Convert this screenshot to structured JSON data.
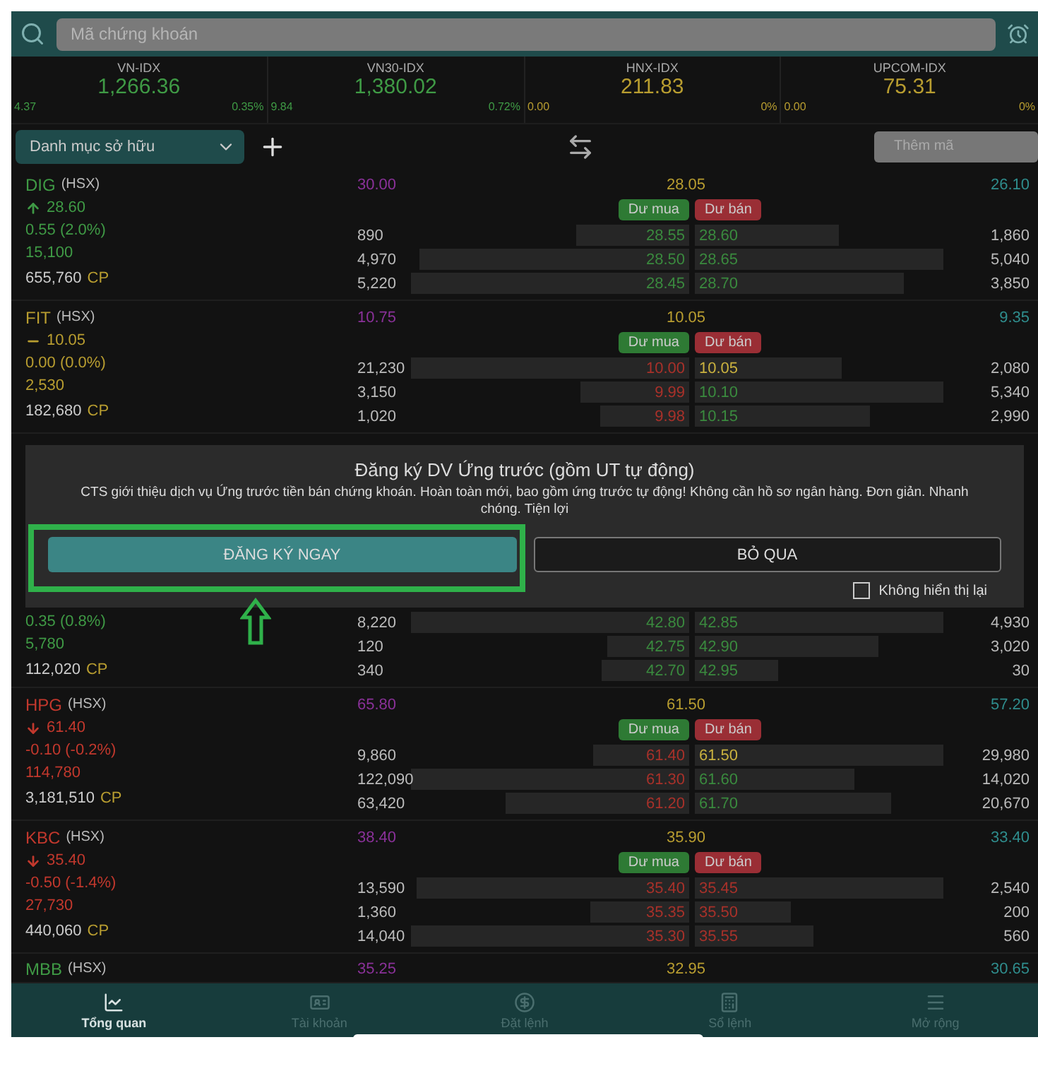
{
  "search": {
    "placeholder": "Mã chứng khoán"
  },
  "indices": [
    {
      "name": "VN-IDX",
      "value": "1,266.36",
      "change": "4.37",
      "percent": "0.35%",
      "color": "#3f9a45"
    },
    {
      "name": "VN30-IDX",
      "value": "1,380.02",
      "change": "9.84",
      "percent": "0.72%",
      "color": "#3f9a45"
    },
    {
      "name": "HNX-IDX",
      "value": "211.83",
      "change": "0.00",
      "percent": "0%",
      "color": "#b89d30"
    },
    {
      "name": "UPCOM-IDX",
      "value": "75.31",
      "change": "0.00",
      "percent": "0%",
      "color": "#b89d30"
    }
  ],
  "toolbar": {
    "watchlist": "Danh mục sở hữu",
    "add_symbol": {
      "placeholder": "Thêm mã"
    }
  },
  "stocks": [
    {
      "symbol": "DIG",
      "exchange": "(HSX)",
      "kind": "up",
      "color": "#3f9a45",
      "price": "28.60",
      "change": "0.55 (2.0%)",
      "volume": "15,100",
      "holding": "655,760",
      "holding_unit": "CP",
      "ceiling": "30.00",
      "reference": "28.05",
      "floor": "26.10",
      "buy_label": "Dư mua",
      "sell_label": "Dư bán",
      "book": [
        {
          "bid": {
            "volume": "890",
            "price": "28.55",
            "color": "#3a8a3e"
          },
          "ask": {
            "volume": "1,860",
            "price": "28.60",
            "color": "#3a8a3e"
          }
        },
        {
          "bid": {
            "volume": "4,970",
            "price": "28.50",
            "color": "#3a8a3e"
          },
          "ask": {
            "volume": "5,040",
            "price": "28.65",
            "color": "#3a8a3e"
          }
        },
        {
          "bid": {
            "volume": "5,220",
            "price": "28.45",
            "color": "#3a8a3e"
          },
          "ask": {
            "volume": "3,850",
            "price": "28.70",
            "color": "#3a8a3e"
          }
        }
      ]
    },
    {
      "symbol": "FIT",
      "exchange": "(HSX)",
      "kind": "flat",
      "color": "#b89d30",
      "price": "10.05",
      "change": "0.00 (0.0%)",
      "volume": "2,530",
      "holding": "182,680",
      "holding_unit": "CP",
      "ceiling": "10.75",
      "reference": "10.05",
      "floor": "9.35",
      "buy_label": "Dư mua",
      "sell_label": "Dư bán",
      "book": [
        {
          "bid": {
            "volume": "21,230",
            "price": "10.00",
            "color": "#a8312a"
          },
          "ask": {
            "volume": "2,080",
            "price": "10.05",
            "color": "#c9b13f"
          }
        },
        {
          "bid": {
            "volume": "3,150",
            "price": "9.99",
            "color": "#a8312a"
          },
          "ask": {
            "volume": "5,340",
            "price": "10.10",
            "color": "#3a8a3e"
          }
        },
        {
          "bid": {
            "volume": "1,020",
            "price": "9.98",
            "color": "#a8312a"
          },
          "ask": {
            "volume": "2,990",
            "price": "10.15",
            "color": "#3a8a3e"
          }
        }
      ]
    }
  ],
  "dialog": {
    "title": "Đăng ký DV Ứng trước (gồm UT tự động)",
    "message": "CTS giới thiệu dịch vụ Ứng trước tiền bán chứng khoán. Hoàn toàn mới, bao gồm ứng trước tự động! Không cần hồ sơ ngân hàng. Đơn giản. Nhanh chóng. Tiện lợi",
    "confirm": "ĐĂNG KÝ NGAY",
    "cancel": "BỎ QUA",
    "dont_show_again": {
      "label": "Không hiển thị lại",
      "checked": false
    }
  },
  "covered_stock": {
    "color": "#3f9a45",
    "change": "0.35 (0.8%)",
    "volume": "5,780",
    "holding": "112,020",
    "holding_unit": "CP",
    "book": [
      {
        "bid": {
          "volume": "8,220",
          "price": "42.80",
          "color": "#3a8a3e"
        },
        "ask": {
          "volume": "4,930",
          "price": "42.85",
          "color": "#3a8a3e"
        }
      },
      {
        "bid": {
          "volume": "120",
          "price": "42.75",
          "color": "#3a8a3e"
        },
        "ask": {
          "volume": "3,020",
          "price": "42.90",
          "color": "#3a8a3e"
        }
      },
      {
        "bid": {
          "volume": "340",
          "price": "42.70",
          "color": "#3a8a3e"
        },
        "ask": {
          "volume": "30",
          "price": "42.95",
          "color": "#3a8a3e"
        }
      }
    ]
  },
  "stocks_below": [
    {
      "symbol": "HPG",
      "exchange": "(HSX)",
      "kind": "down",
      "color": "#c2382d",
      "price": "61.40",
      "change": "-0.10 (-0.2%)",
      "volume": "114,780",
      "holding": "3,181,510",
      "holding_unit": "CP",
      "ceiling": "65.80",
      "reference": "61.50",
      "floor": "57.20",
      "buy_label": "Dư mua",
      "sell_label": "Dư bán",
      "book": [
        {
          "bid": {
            "volume": "9,860",
            "price": "61.40",
            "color": "#a8312a"
          },
          "ask": {
            "volume": "29,980",
            "price": "61.50",
            "color": "#c9b13f"
          }
        },
        {
          "bid": {
            "volume": "122,090",
            "price": "61.30",
            "color": "#a8312a"
          },
          "ask": {
            "volume": "14,020",
            "price": "61.60",
            "color": "#3a8a3e"
          }
        },
        {
          "bid": {
            "volume": "63,420",
            "price": "61.20",
            "color": "#a8312a"
          },
          "ask": {
            "volume": "20,670",
            "price": "61.70",
            "color": "#3a8a3e"
          }
        }
      ]
    },
    {
      "symbol": "KBC",
      "exchange": "(HSX)",
      "kind": "down",
      "color": "#c2382d",
      "price": "35.40",
      "change": "-0.50 (-1.4%)",
      "volume": "27,730",
      "holding": "440,060",
      "holding_unit": "CP",
      "ceiling": "38.40",
      "reference": "35.90",
      "floor": "33.40",
      "buy_label": "Dư mua",
      "sell_label": "Dư bán",
      "book": [
        {
          "bid": {
            "volume": "13,590",
            "price": "35.40",
            "color": "#a8312a"
          },
          "ask": {
            "volume": "2,540",
            "price": "35.45",
            "color": "#a8312a"
          }
        },
        {
          "bid": {
            "volume": "1,360",
            "price": "35.35",
            "color": "#a8312a"
          },
          "ask": {
            "volume": "200",
            "price": "35.50",
            "color": "#a8312a"
          }
        },
        {
          "bid": {
            "volume": "14,040",
            "price": "35.30",
            "color": "#a8312a"
          },
          "ask": {
            "volume": "560",
            "price": "35.55",
            "color": "#a8312a"
          }
        }
      ]
    }
  ],
  "peek_stock": {
    "symbol": "MBB",
    "exchange": "(HSX)",
    "color": "#3f9a45",
    "ceiling": "35.25",
    "reference": "32.95",
    "floor": "30.65"
  },
  "nav": [
    {
      "label": "Tổng quan",
      "selected": true
    },
    {
      "label": "Tài khoản",
      "selected": false
    },
    {
      "label": "Đặt lệnh",
      "selected": false
    },
    {
      "label": "Sổ lệnh",
      "selected": false
    },
    {
      "label": "Mở rộng",
      "selected": false
    }
  ]
}
